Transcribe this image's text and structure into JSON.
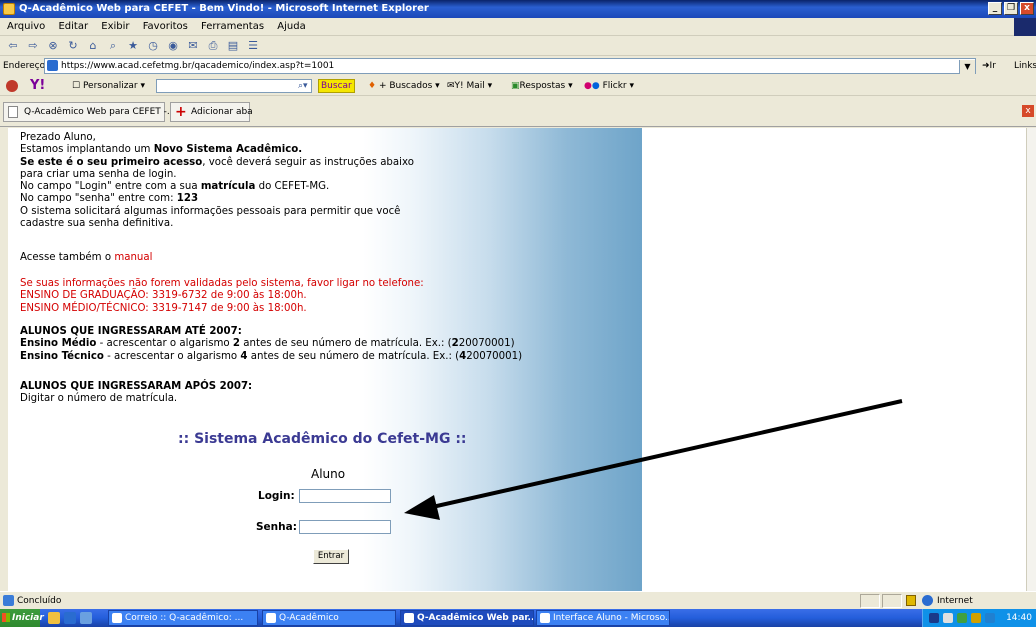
{
  "window": {
    "title": "Q-Acadêmico Web para CEFET - Bem Vindo! - Microsoft Internet Explorer",
    "buttons": [
      "_",
      "❒",
      "x"
    ]
  },
  "menu": [
    "Arquivo",
    "Editar",
    "Exibir",
    "Favoritos",
    "Ferramentas",
    "Ajuda"
  ],
  "toolbar_icons": [
    "back-icon",
    "forward-icon",
    "stop-icon",
    "refresh-icon",
    "home-icon",
    "search-icon",
    "favorites-icon",
    "history-icon",
    "media-icon",
    "mail-icon",
    "print-icon",
    "edit-icon",
    "discuss-icon"
  ],
  "address": {
    "label": "Endereço",
    "url": "https://www.acad.cefetmg.br/qacademico/index.asp?t=1001",
    "go": "Ir",
    "links": "Links"
  },
  "yahoo_toolbar": {
    "logo": "Y!",
    "personalizar": "Personalizar",
    "buscar": "Buscar",
    "buscados": "+ Buscados",
    "mail": "Y! Mail",
    "respostas": "Respostas",
    "flickr": "Flickr"
  },
  "tabs": [
    {
      "label": "Q-Acadêmico Web para CEFET -..."
    },
    {
      "label": "Adicionar aba"
    }
  ],
  "content": {
    "lines": [
      "Prezado Aluno,",
      "Estamos implantando um ",
      "Novo Sistema Acadêmico.",
      "Se este é o seu primeiro acesso",
      ", você deverá seguir as instruções abaixo",
      "para criar uma senha de login.",
      "No campo \"Login\" entre com a sua ",
      "matrícula",
      " do CEFET-MG.",
      "No campo \"senha\" entre com: ",
      "123",
      "O sistema solicitará algumas informações pessoais para permitir que você",
      "cadastre sua senha definitiva."
    ],
    "acesse_prefix": "Acesse também o ",
    "manual_link": "manual",
    "warning": [
      "Se suas informações não forem validadas pelo sistema, favor ligar no telefone:",
      "ENSINO DE GRADUAÇÃO: 3319-6732 de 9:00 às 18:00h.",
      "ENSINO MÉDIO/TÉCNICO: 3319-7147 de 9:00 às 18:00h."
    ],
    "ate2007": {
      "heading": "ALUNOS QUE INGRESSARAM ATÉ 2007:",
      "medio_label": "Ensino Médio",
      "medio_pre": " - acrescentar o algarismo ",
      "medio_digit": "2",
      "medio_post": " antes de seu número de matrícula. Ex.: (",
      "medio_ex_bold": "2",
      "medio_ex_rest": "20070001)",
      "tecnico_label": "Ensino Técnico",
      "tecnico_pre": " - acrescentar o algarismo ",
      "tecnico_digit": "4",
      "tecnico_post": " antes de seu número de matrícula. Ex.: (",
      "tecnico_ex_bold": "4",
      "tecnico_ex_rest": "20070001)"
    },
    "apos2007": {
      "heading": "ALUNOS QUE INGRESSARAM APÓS 2007:",
      "text": "Digitar o número de matrícula."
    },
    "system_title": ":: Sistema Acadêmico do Cefet-MG ::",
    "aluno": "Aluno",
    "login_label": "Login:",
    "senha_label": "Senha:",
    "login_value": "",
    "senha_value": "",
    "entrar": "Entrar"
  },
  "status": {
    "text": "Concluído",
    "zone": "Internet"
  },
  "taskbar": {
    "start": "Iniciar",
    "buttons": [
      {
        "label": "Correio :: Q-acadêmico: ...",
        "active": false
      },
      {
        "label": "Q-Acadêmico",
        "active": false
      },
      {
        "label": "Q-Acadêmico Web par...",
        "active": true
      },
      {
        "label": "Interface Aluno - Microso...",
        "active": false
      }
    ],
    "clock": "14:40"
  },
  "colors": {
    "title_bar": "#0a246a",
    "warning_red": "#d40000",
    "system_title": "#3b3a93",
    "gradient_blue": "#6ea4c9"
  }
}
